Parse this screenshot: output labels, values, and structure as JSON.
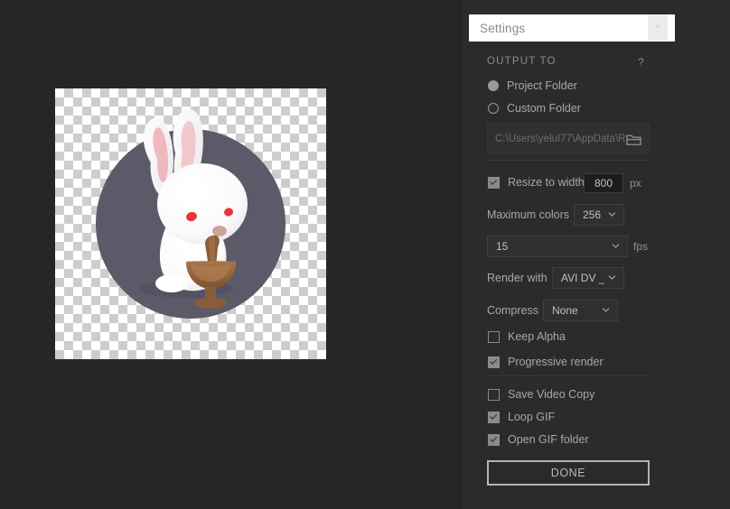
{
  "window": {
    "background_color": "#262626",
    "panel_background_color": "#2b2b2b"
  },
  "preview": {
    "name": "gif-preview-canvas",
    "transparency_checker": true,
    "artwork_description": "white rabbit with mortar and pestle on dark circle",
    "circle_color": "#5b5a68",
    "rabbit_color": "#fdfdfd",
    "mortar_color": "#9a6b3f",
    "eye_color": "#e8343c"
  },
  "panel": {
    "title": "Settings",
    "close_label": "×",
    "section_output": "OUTPUT TO",
    "help_label": "?",
    "output_options": [
      {
        "label": "Project Folder",
        "selected": true
      },
      {
        "label": "Custom Folder",
        "selected": false
      }
    ],
    "path_value": "C:\\Users\\yeluI77\\AppData\\R",
    "folder_icon": "folder-icon",
    "resize": {
      "label": "Resize to width",
      "checked": true,
      "value": "800",
      "unit": "px"
    },
    "max_colors": {
      "label": "Maximum colors",
      "value": "256"
    },
    "fps": {
      "value": "15",
      "unit": "fps"
    },
    "render_with": {
      "label": "Render with",
      "value": "AVI DV _"
    },
    "compress": {
      "label": "Compress",
      "value": "None"
    },
    "toggles_group_one": [
      {
        "label": "Keep Alpha",
        "checked": false
      },
      {
        "label": "Progressive render",
        "checked": true
      }
    ],
    "toggles_group_two": [
      {
        "label": "Save Video Copy",
        "checked": false
      },
      {
        "label": "Loop GIF",
        "checked": true
      },
      {
        "label": "Open GIF folder",
        "checked": true
      }
    ],
    "done_label": "DONE"
  }
}
